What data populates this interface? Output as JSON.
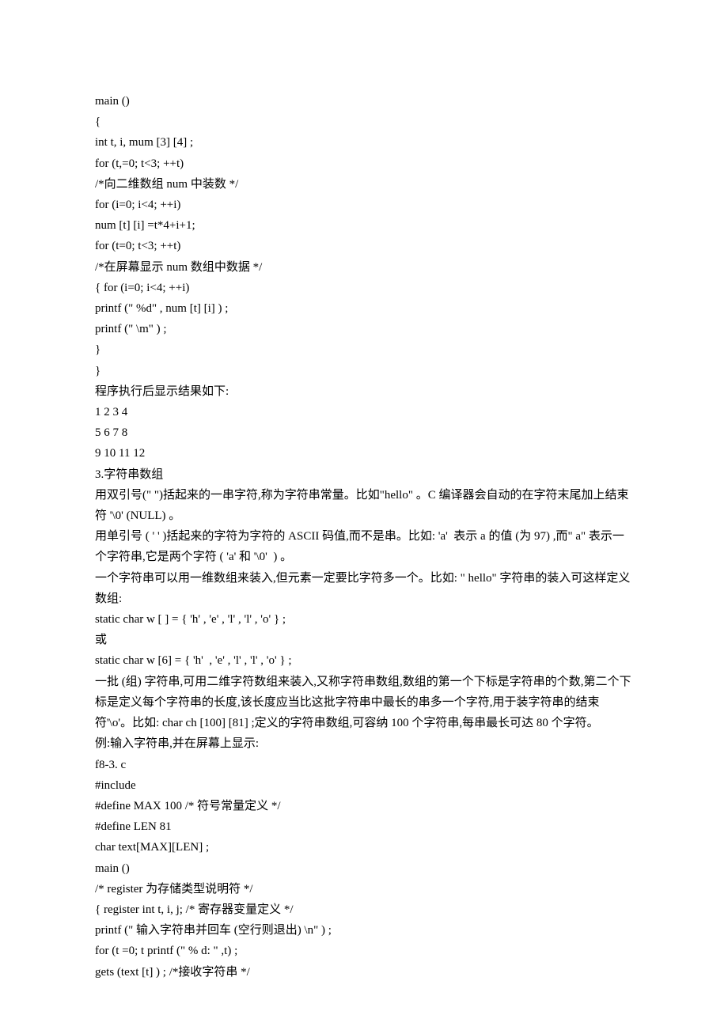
{
  "lines": [
    "main ()",
    "{",
    "int t, i, mum [3] [4] ;",
    "for (t,=0; t<3; ++t)",
    "/*向二维数组 num 中装数 */",
    "for (i=0; i<4; ++i)",
    "num [t] [i] =t*4+i+1;",
    "for (t=0; t<3; ++t)",
    "/*在屏幕显示 num 数组中数据 */",
    "{ for (i=0; i<4; ++i)",
    "printf (\" %d\" , num [t] [i] ) ;",
    "printf (\" \\m\" ) ;",
    "}",
    "}",
    "程序执行后显示结果如下:",
    "1 2 3 4",
    "5 6 7 8",
    "9 10 11 12",
    "3.字符串数组",
    "用双引号(\" \")括起来的一串字符,称为字符串常量。比如\"hello\" 。C 编译器会自动的在字符末尾加上结束符 '\\0' (NULL) 。",
    "用单引号 ( ' ' )括起来的字符为字符的 ASCII 码值,而不是串。比如: 'a'  表示 a 的值 (为 97) ,而\" a\" 表示一个字符串,它是两个字符 ( 'a' 和 '\\0'  ) 。",
    "一个字符串可以用一维数组来装入,但元素一定要比字符多一个。比如: \" hello\" 字符串的装入可这样定义数组:",
    "static char w [ ] = { 'h' , 'e' , 'l' , 'l' , 'o' } ;",
    "或",
    "static char w [6] = { 'h'  , 'e' , 'l' , 'l' , 'o' } ;",
    "一批 (组) 字符串,可用二维字符数组来装入,又称字符串数组,数组的第一个下标是字符串的个数,第二个下标是定义每个字符串的长度,该长度应当比这批字符串中最长的串多一个字符,用于装字符串的结束符'\\o'。比如: char ch [100] [81] ;定义的字符串数组,可容纳 100 个字符串,每串最长可达 80 个字符。",
    "例:输入字符串,并在屏幕上显示:",
    "f8-3. c",
    "#include",
    "#define MAX 100 /* 符号常量定义 */",
    "#define LEN 81",
    "char text[MAX][LEN] ;",
    "main ()",
    "/* register 为存储类型说明符 */",
    "{ register int t, i, j; /* 寄存器变量定义 */",
    "printf (\" 输入字符串并回车 (空行则退出) \\n\" ) ;",
    "for (t =0; t printf (\" % d: \" ,t) ;",
    "gets (text [t] ) ; /*接收字符串 */"
  ]
}
